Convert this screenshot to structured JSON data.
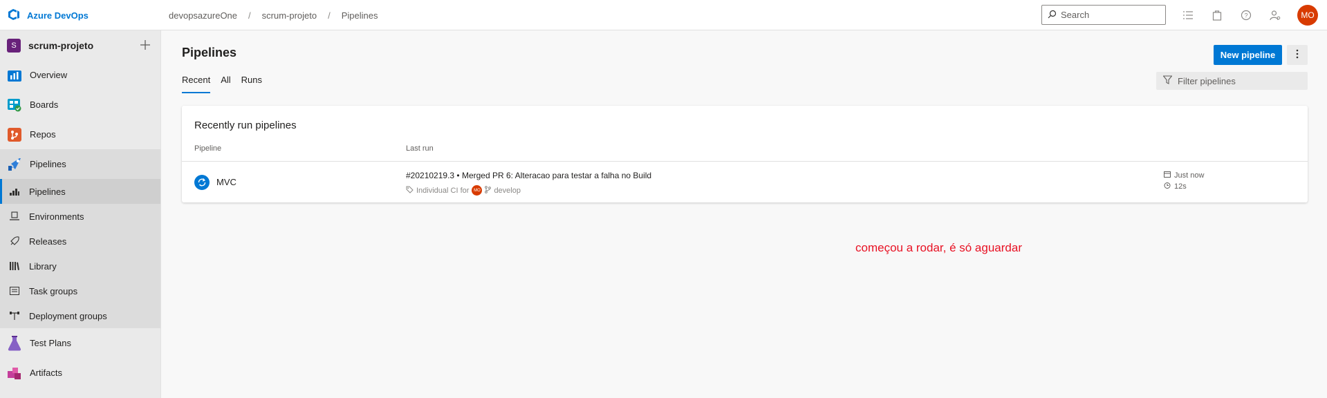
{
  "brand": {
    "name": "Azure DevOps",
    "accent": "#0078d4"
  },
  "breadcrumb": [
    "devopsazureOne",
    "scrum-projeto",
    "Pipelines"
  ],
  "search": {
    "placeholder": "Search"
  },
  "user": {
    "initials": "MO",
    "color": "#d83b01"
  },
  "project": {
    "badge": "S",
    "name": "scrum-projeto",
    "color": "#68217a"
  },
  "sidebar": {
    "items": [
      {
        "label": "Overview",
        "icon": "overview-icon"
      },
      {
        "label": "Boards",
        "icon": "boards-icon"
      },
      {
        "label": "Repos",
        "icon": "repos-icon"
      }
    ],
    "pipelines_group": {
      "label": "Pipelines",
      "children": [
        {
          "label": "Pipelines",
          "icon": "pipelines-sub-icon",
          "active": true
        },
        {
          "label": "Environments",
          "icon": "environments-icon"
        },
        {
          "label": "Releases",
          "icon": "releases-icon"
        },
        {
          "label": "Library",
          "icon": "library-icon"
        },
        {
          "label": "Task groups",
          "icon": "task-groups-icon"
        },
        {
          "label": "Deployment groups",
          "icon": "deployment-groups-icon"
        }
      ]
    },
    "bottom_items": [
      {
        "label": "Test Plans",
        "icon": "test-plans-icon"
      },
      {
        "label": "Artifacts",
        "icon": "artifacts-icon"
      }
    ]
  },
  "main": {
    "title": "Pipelines",
    "new_button": "New pipeline",
    "tabs": [
      "Recent",
      "All",
      "Runs"
    ],
    "filter_placeholder": "Filter pipelines",
    "card": {
      "title": "Recently run pipelines",
      "columns": [
        "Pipeline",
        "Last run"
      ],
      "rows": [
        {
          "name": "MVC",
          "run_title": "#20210219.3 • Merged PR 6: Alteracao para testar a falha no Build",
          "trigger": "Individual CI for",
          "avatar": "MO",
          "branch": "develop",
          "when": "Just now",
          "duration": "12s"
        }
      ]
    }
  },
  "annotation": {
    "text": "começou a rodar, é só aguardar",
    "color": "#e81123"
  }
}
